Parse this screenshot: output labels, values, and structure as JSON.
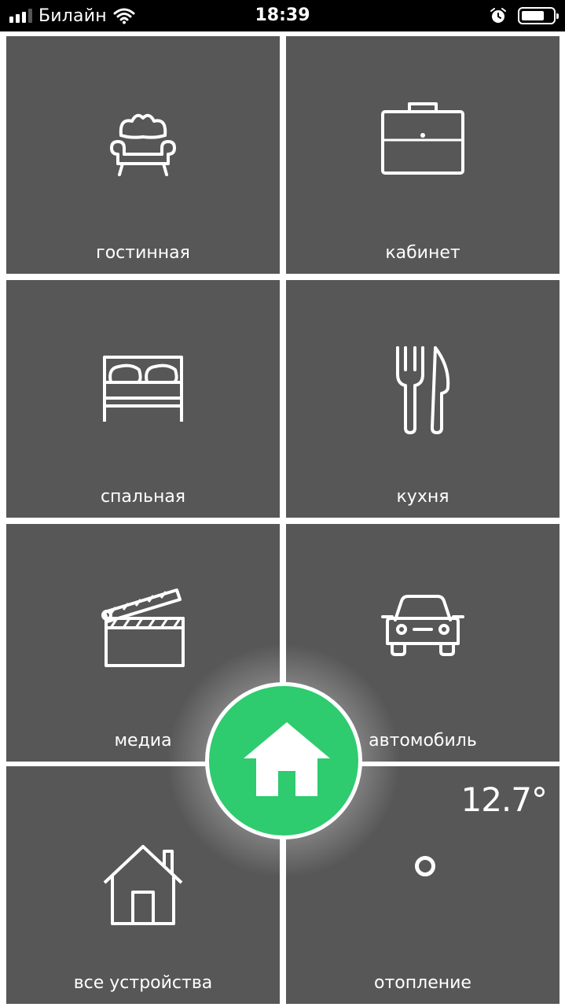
{
  "status_bar": {
    "carrier": "Билайн",
    "time": "18:39",
    "icons": [
      "signal-icon",
      "wifi-icon",
      "alarm-icon",
      "battery-icon"
    ]
  },
  "tiles": [
    {
      "label": "гостинная",
      "icon": "sofa-icon"
    },
    {
      "label": "кабинет",
      "icon": "briefcase-icon"
    },
    {
      "label": "спальная",
      "icon": "bed-icon"
    },
    {
      "label": "кухня",
      "icon": "cutlery-icon"
    },
    {
      "label": "медиа",
      "icon": "clapperboard-icon"
    },
    {
      "label": "автомобиль",
      "icon": "car-icon"
    },
    {
      "label": "все устройства",
      "icon": "house-icon"
    },
    {
      "label": "отопление",
      "icon": "heating-icon",
      "temperature": "12.7°"
    }
  ],
  "home_button": {
    "icon": "home-icon"
  },
  "colors": {
    "tile": "#575757",
    "accent": "#2ecb6f",
    "background": "#ffffff",
    "status_bar": "#000000"
  }
}
